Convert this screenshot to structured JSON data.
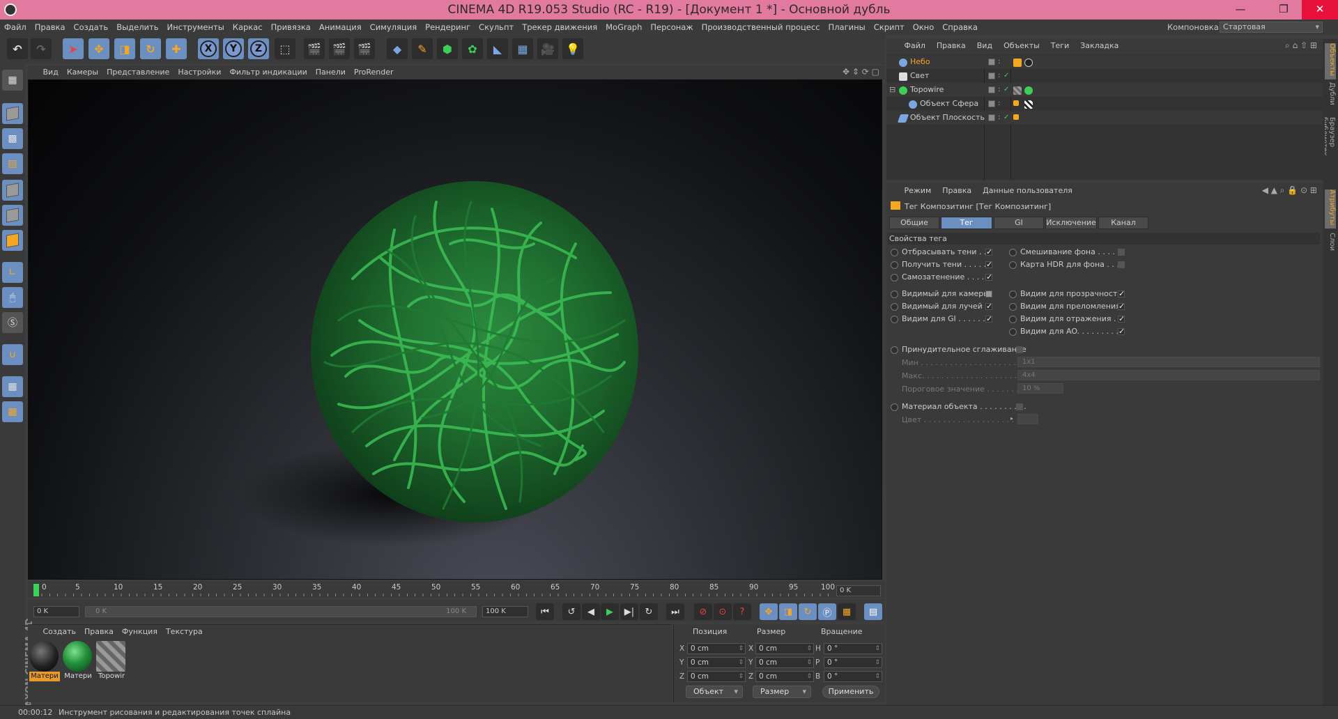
{
  "window": {
    "title": "CINEMA 4D R19.053 Studio (RC - R19) - [Документ 1 *] - Основной дубль",
    "controls": [
      "—",
      "❐",
      "✕"
    ]
  },
  "menubar": {
    "items": [
      "Файл",
      "Правка",
      "Создать",
      "Выделить",
      "Инструменты",
      "Каркас",
      "Привязка",
      "Анимация",
      "Симуляция",
      "Рендеринг",
      "Скульпт",
      "Трекер движения",
      "MoGraph",
      "Персонаж",
      "Производственный процесс",
      "Плагины",
      "Скрипт",
      "Окно",
      "Справка"
    ],
    "layout_label": "Компоновка",
    "layout_value": "Стартовая"
  },
  "toolbar": {
    "axes": [
      "X",
      "Y",
      "Z"
    ]
  },
  "viewport": {
    "menu": [
      "Вид",
      "Камеры",
      "Представление",
      "Настройки",
      "Фильтр индикации",
      "Панели",
      "ProRender"
    ]
  },
  "timeline": {
    "ticks": [
      "0",
      "5",
      "10",
      "15",
      "20",
      "25",
      "30",
      "35",
      "40",
      "45",
      "50",
      "55",
      "60",
      "65",
      "70",
      "75",
      "80",
      "85",
      "90",
      "95",
      "100"
    ],
    "current_frame_field": "0 K",
    "start_field": "0 K",
    "range_start": "0 K",
    "range_end": "100 K",
    "end_field": "100 K"
  },
  "materials": {
    "menu": [
      "Создать",
      "Правка",
      "Функция",
      "Текстура"
    ],
    "items": [
      "Матери",
      "Матери",
      "Topowir"
    ]
  },
  "coords": {
    "headers": [
      "Позиция",
      "Размер",
      "Вращение"
    ],
    "rows": [
      {
        "a": "X",
        "pos": "0 cm",
        "b": "X",
        "size": "0 cm",
        "c": "H",
        "rot": "0 °"
      },
      {
        "a": "Y",
        "pos": "0 cm",
        "b": "Y",
        "size": "0 cm",
        "c": "P",
        "rot": "0 °"
      },
      {
        "a": "Z",
        "pos": "0 cm",
        "b": "Z",
        "size": "0 cm",
        "c": "B",
        "rot": "0 °"
      }
    ],
    "mode_dropdown": "Объект",
    "size_dropdown": "Размер",
    "apply_label": "Применить"
  },
  "status": {
    "time": "00:00:12",
    "message": "Инструмент рисования и редактирования точек сплайна"
  },
  "objects": {
    "menu": [
      "Файл",
      "Правка",
      "Вид",
      "Объекты",
      "Теги",
      "Закладка"
    ],
    "items": [
      {
        "name": "Небо",
        "active": true
      },
      {
        "name": "Свет",
        "active": false
      },
      {
        "name": "Topowire",
        "active": false
      },
      {
        "name": "Объект Сфера",
        "active": false
      },
      {
        "name": "Объект Плоскость",
        "active": false
      }
    ]
  },
  "attributes": {
    "menu": [
      "Режим",
      "Правка",
      "Данные пользователя"
    ],
    "title": "Тег Композитинг [Тег Композитинг]",
    "tabs": [
      "Общие",
      "Тег",
      "GI",
      "Исключение",
      "Канал"
    ],
    "section": "Свойства тега",
    "left_props": [
      {
        "label": "Отбрасывать тени . . .",
        "checked": true
      },
      {
        "label": "Получить тени . . . . . .",
        "checked": true
      },
      {
        "label": "Самозатенение . . . . .",
        "checked": true
      },
      {
        "label": "Видимый для камеры",
        "checked": false
      },
      {
        "label": "Видимый для лучей",
        "checked": true
      },
      {
        "label": "Видим для GI . . . . . . .",
        "checked": true
      }
    ],
    "right_props": [
      {
        "label": "Смешивание фона . . . . .",
        "checked": false
      },
      {
        "label": "Карта HDR для фона . . . .",
        "checked": false
      },
      {
        "label": "Видим для прозрачности",
        "checked": true
      },
      {
        "label": "Видим для преломления",
        "checked": true
      },
      {
        "label": "Видим для отражения . .",
        "checked": true
      },
      {
        "label": "Видим для AO. . . . . . . . .",
        "checked": true
      }
    ],
    "force_aa": {
      "label": "Принудительное сглаживание",
      "checked": false
    },
    "min": {
      "label": "Мин . . . . . . . . . . . . . . . . . . . . . .",
      "value": "1x1"
    },
    "max": {
      "label": "Макс. . . . . . . . . . . . . . . . . . . . . .",
      "value": "4x4"
    },
    "threshold": {
      "label": "Пороговое значение . . . . . . . .",
      "value": "10 %"
    },
    "obj_material": {
      "label": "Материал объекта . . . . . . . . . .",
      "checked": false
    },
    "color": {
      "label": "Цвет . . . . . . . . . . . . . . . . . . . . . ."
    }
  },
  "sidetabs": [
    "Объекты",
    "Дубли",
    "Браузер библиотек",
    "Атрибуты",
    "Слои"
  ]
}
